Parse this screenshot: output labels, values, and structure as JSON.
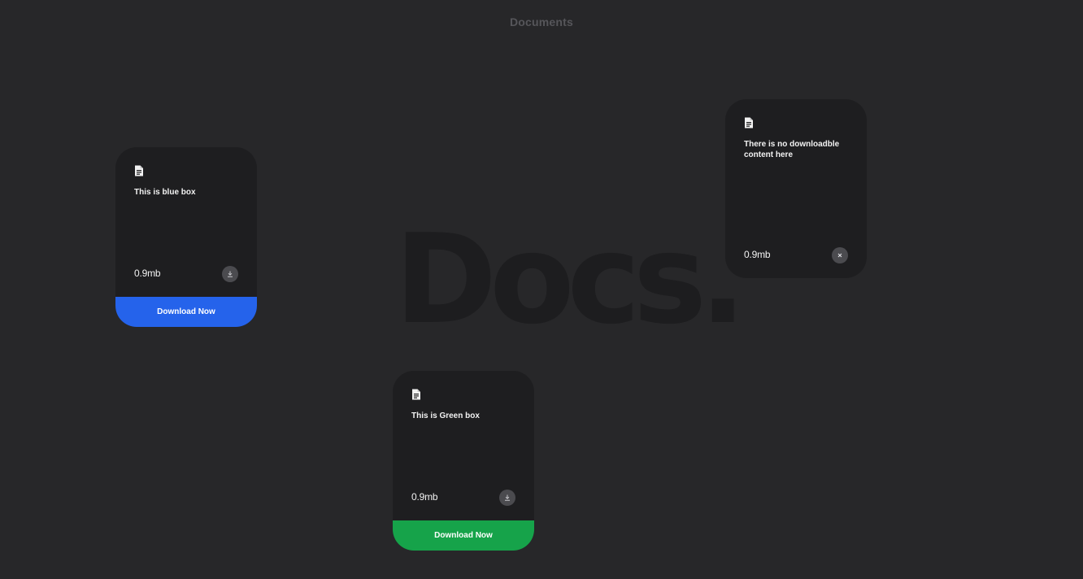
{
  "header": {
    "title": "Documents"
  },
  "watermark": {
    "text": "Docs."
  },
  "cards": [
    {
      "title": "This is blue box",
      "size": "0.9mb",
      "action_icon": "download-icon",
      "download_label": "Download Now",
      "accent_color": "#2563eb"
    },
    {
      "title": "There is no downloadble content here",
      "size": "0.9mb",
      "action_icon": "close-icon"
    },
    {
      "title": "This is Green box",
      "size": "0.9mb",
      "action_icon": "download-icon",
      "download_label": "Download Now",
      "accent_color": "#16a34a"
    }
  ],
  "colors": {
    "background": "#272729",
    "card": "#1e1e20",
    "blue": "#2563eb",
    "green": "#16a34a"
  }
}
